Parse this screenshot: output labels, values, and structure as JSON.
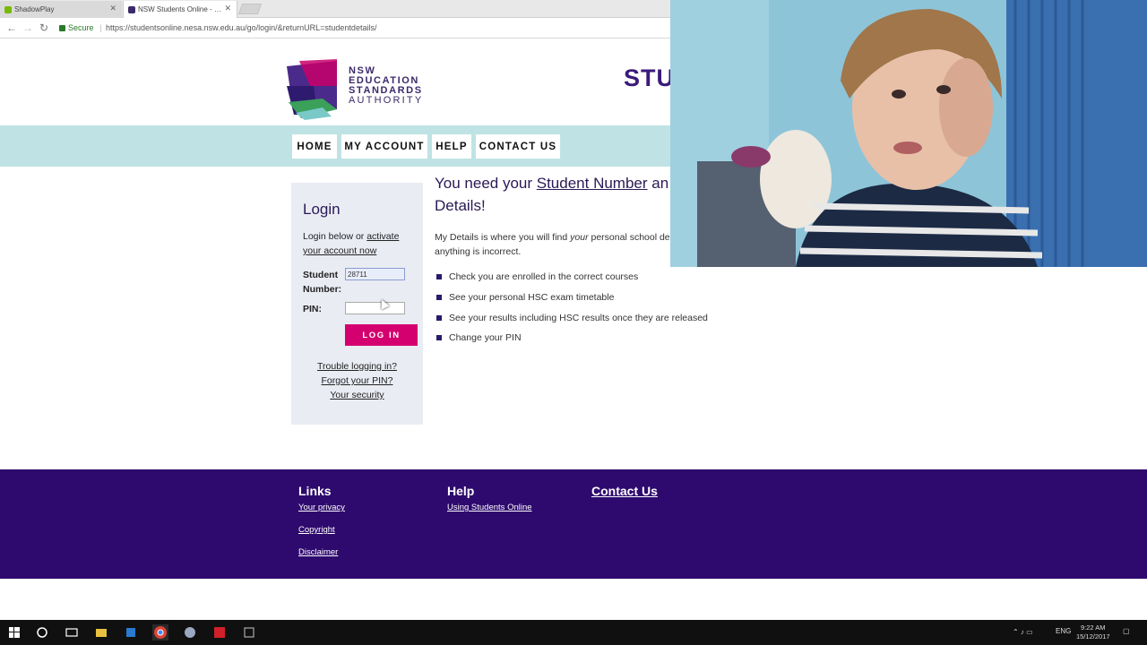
{
  "browser": {
    "tabs": [
      {
        "label": "ShadowPlay",
        "color": "#76b900"
      },
      {
        "label": "NSW Students Online - …",
        "color": "#3b2a6a"
      }
    ],
    "secure_label": "Secure",
    "url": "https://studentsonline.nesa.nsw.edu.au/go/login/&returnURL=studentdetails/"
  },
  "header": {
    "logo_lines": [
      "NSW",
      "EDUCATION",
      "STANDARDS",
      "AUTHORITY"
    ],
    "site_title": "STU"
  },
  "nav": {
    "items": [
      "HOME",
      "MY ACCOUNT",
      "HELP",
      "CONTACT US"
    ]
  },
  "login": {
    "title": "Login",
    "intro_prefix": "Login below or ",
    "intro_link": "activate your account now",
    "student_number_label_1": "Student",
    "student_number_label_2": "Number:",
    "student_number_value": "28711",
    "pin_label": "PIN:",
    "pin_value": "",
    "button_label": "LOG IN",
    "links": [
      "Trouble logging in?",
      "Forgot your PIN?",
      "Your security"
    ]
  },
  "main": {
    "headline_prefix": "You need your ",
    "headline_link": "Student Number",
    "headline_suffix": " an",
    "headline_line2": "Details!",
    "desc_line1_a": "My Details is where you will find ",
    "desc_line1_em": "your",
    "desc_line1_b": " personal school de",
    "desc_line2": "anything is incorrect.",
    "bullets": [
      "Check you are enrolled in the correct courses",
      "See your personal HSC exam timetable",
      "See your results including HSC results once they are released",
      "Change your PIN"
    ]
  },
  "footer": {
    "links_heading": "Links",
    "links": [
      "Your privacy",
      "Copyright",
      "Disclaimer"
    ],
    "help_heading": "Help",
    "help_links": [
      "Using Students Online"
    ],
    "contact_heading": "Contact Us"
  },
  "taskbar": {
    "time": "9:22 AM",
    "date": "15/12/2017",
    "lang": "ENG"
  },
  "colors": {
    "brand_purple": "#2e0a6e",
    "accent_pink": "#d4006f",
    "nav_band": "#bfe3e4",
    "login_panel": "#eaecf4"
  }
}
